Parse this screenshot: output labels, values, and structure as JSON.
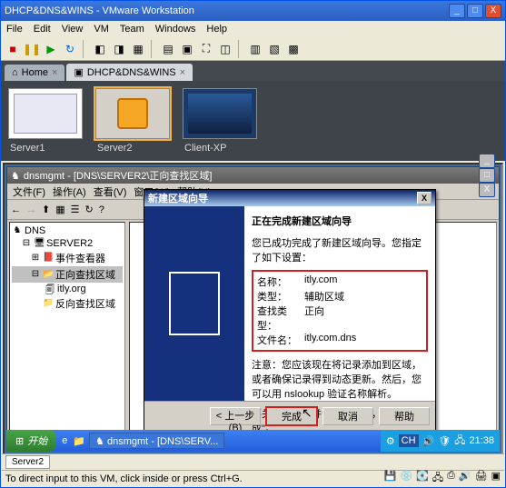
{
  "vmware": {
    "title": "DHCP&DNS&WINS - VMware Workstation",
    "menu": [
      "File",
      "Edit",
      "View",
      "VM",
      "Team",
      "Windows",
      "Help"
    ],
    "tabs": [
      {
        "label": "Home"
      },
      {
        "label": "DHCP&DNS&WINS"
      }
    ],
    "thumbs": [
      {
        "label": "Server1"
      },
      {
        "label": "Server2"
      },
      {
        "label": "Client-XP"
      }
    ],
    "bottom_tab": "Server2",
    "status_text": "To direct input to this VM, click inside or press Ctrl+G."
  },
  "dnsmgmt": {
    "title": "dnsmgmt - [DNS\\SERVER2\\正向查找区域]",
    "menu": [
      "文件(F)",
      "操作(A)",
      "查看(V)",
      "窗口(W)",
      "帮助(H)"
    ],
    "tree": {
      "root": "DNS",
      "server": "SERVER2",
      "nodes": [
        {
          "label": "事件查看器"
        },
        {
          "label": "正向查找区域"
        },
        {
          "label": "itly.org"
        },
        {
          "label": "反向查找区域"
        }
      ]
    }
  },
  "wizard": {
    "title": "新建区域向导",
    "heading": "正在完成新建区域向导",
    "intro": "您已成功完成了新建区域向导。您指定了如下设置：",
    "rows": [
      {
        "k": "名称：",
        "v": "itly.com"
      },
      {
        "k": "类型：",
        "v": "辅助区域"
      },
      {
        "k": "查找类型：",
        "v": "正向"
      },
      {
        "k": "文件名：",
        "v": "itly.com.dns"
      }
    ],
    "note": "注意：您应该现在将记录添加到区域，或者确保记录得到动态更新。然后，您可以用 nslookup 验证名称解析。",
    "close_text": "要关闭此向导并创建新区域，请单击\"完成\"。",
    "btn_back": "< 上一步(B)",
    "btn_finish": "完成",
    "btn_cancel": "取消",
    "btn_help": "帮助"
  },
  "xp": {
    "start": "开始",
    "task": "dnsmgmt - [DNS\\SERV...",
    "lang": "CH",
    "clock": "21:38"
  }
}
